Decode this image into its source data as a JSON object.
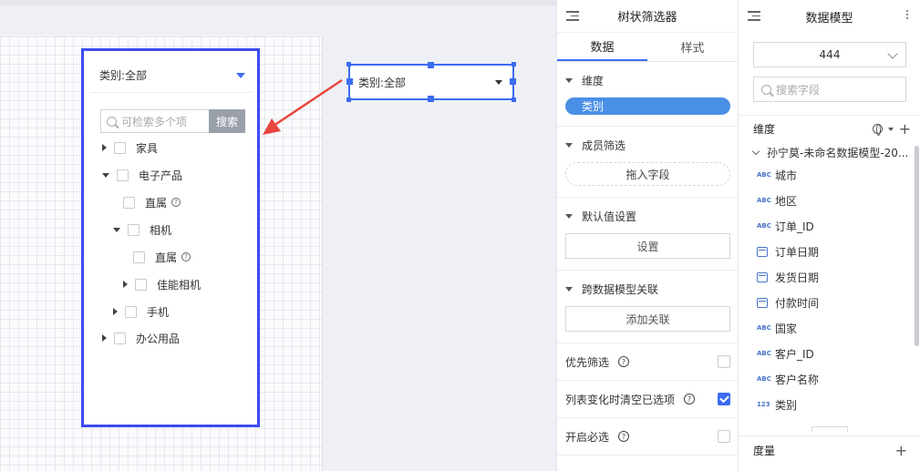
{
  "canvas": {
    "tree_widget": {
      "header_label": "类别:全部",
      "search_placeholder": "可检索多个项",
      "search_button": "搜索",
      "nodes": [
        {
          "label": "家具",
          "level": 0,
          "expanded": false,
          "help": false
        },
        {
          "label": "电子产品",
          "level": 0,
          "expanded": true,
          "help": false
        },
        {
          "label": "直属",
          "level": 1,
          "expanded": null,
          "help": true
        },
        {
          "label": "相机",
          "level": 1,
          "expanded": true,
          "help": false
        },
        {
          "label": "直属",
          "level": 2,
          "expanded": null,
          "help": true
        },
        {
          "label": "佳能相机",
          "level": 2,
          "expanded": false,
          "help": false
        },
        {
          "label": "手机",
          "level": 1,
          "expanded": false,
          "help": false
        },
        {
          "label": "办公用品",
          "level": 0,
          "expanded": false,
          "help": false
        }
      ]
    },
    "compact_widget": {
      "label": "类别:全部"
    },
    "arrow_color": "#e8473f",
    "selection_color": "#3b4cf2"
  },
  "filter_panel": {
    "title": "树状筛选器",
    "tabs": [
      {
        "label": "数据",
        "active": true
      },
      {
        "label": "样式",
        "active": false
      }
    ],
    "dimension": {
      "title": "维度",
      "field": "类别"
    },
    "member_filter": {
      "title": "成员筛选",
      "drop_label": "拖入字段"
    },
    "default_value": {
      "title": "默认值设置",
      "button": "设置"
    },
    "cross_model": {
      "title": "跨数据模型关联",
      "button": "添加关联"
    },
    "options": [
      {
        "label": "优先筛选",
        "checked": false
      },
      {
        "label": "列表变化时清空已选项",
        "checked": true
      },
      {
        "label": "开启必选",
        "checked": false
      }
    ]
  },
  "model_panel": {
    "title": "数据模型",
    "model_select": "444",
    "search_placeholder": "搜索字段",
    "dimension_title": "维度",
    "model_name": "孙宁莫-未命名数据模型-20...",
    "fields": [
      {
        "type": "ABC",
        "name": "城市"
      },
      {
        "type": "ABC",
        "name": "地区"
      },
      {
        "type": "ABC",
        "name": "订单_ID"
      },
      {
        "type": "date",
        "name": "订单日期"
      },
      {
        "type": "date",
        "name": "发货日期"
      },
      {
        "type": "time",
        "name": "付款时间"
      },
      {
        "type": "ABC",
        "name": "国家"
      },
      {
        "type": "ABC",
        "name": "客户_ID"
      },
      {
        "type": "ABC",
        "name": "客户名称"
      },
      {
        "type": "123",
        "name": "类别"
      }
    ],
    "measure_title": "度量"
  }
}
